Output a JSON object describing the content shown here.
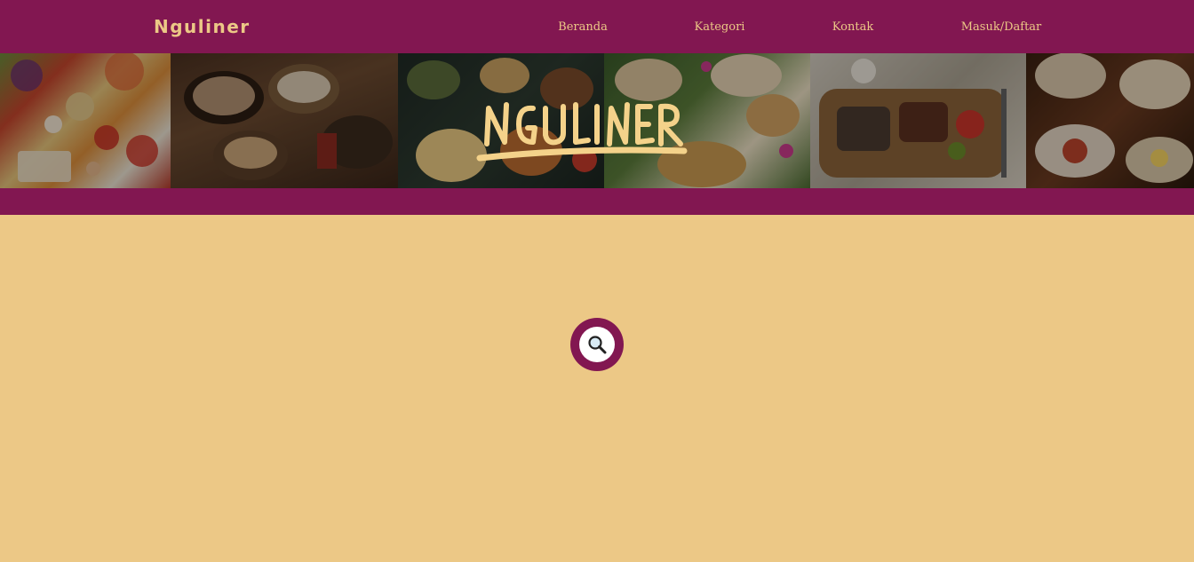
{
  "header": {
    "brand": "Nguliner",
    "nav": [
      "Beranda",
      "Kategori",
      "Kontak",
      "Masuk/Daftar"
    ]
  },
  "hero": {
    "logo_text": "NGULINER"
  },
  "search": {
    "icon": "search-icon"
  },
  "colors": {
    "primary": "#821751",
    "accent": "#ecc886",
    "background": "#ecc886"
  }
}
